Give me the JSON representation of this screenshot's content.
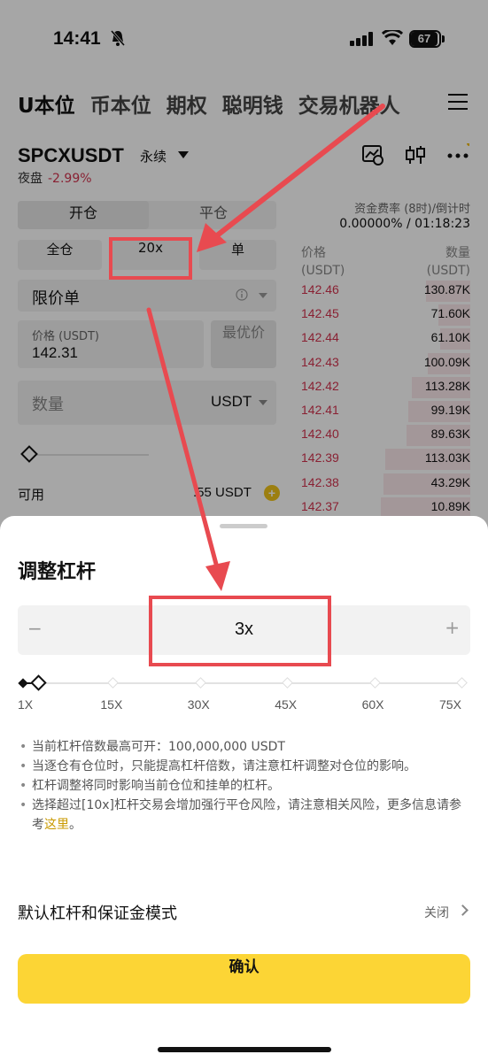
{
  "status": {
    "time": "14:41",
    "battery": "67"
  },
  "nav": {
    "tabs": [
      "U本位",
      "币本位",
      "期权",
      "聪明钱",
      "交易机器人"
    ]
  },
  "pair": {
    "symbol": "SPCXUSDT",
    "type": "永续",
    "session": "夜盘",
    "change": "-2.99%"
  },
  "form": {
    "open_tab": "开仓",
    "close_tab": "平仓",
    "margin_mode": "全仓",
    "leverage": "20x",
    "position_mode": "单",
    "order_type": "限价单",
    "price_label": "价格 (USDT)",
    "price_value": "142.31",
    "best_price": "最优价",
    "qty_placeholder": "数量",
    "qty_unit": "USDT",
    "available_label": "可用",
    "available_value": ".55 USDT",
    "coin_icon": "+"
  },
  "orderbook": {
    "funding_label": "资金费率 (8时)/倒计时",
    "funding_value": "0.00000% / 01:18:23",
    "price_header": "价格",
    "price_unit": "(USDT)",
    "amount_header": "数量",
    "amount_unit": "(USDT)",
    "rows": [
      {
        "price": "142.46",
        "amount": "130.87K",
        "depth": 0.42
      },
      {
        "price": "142.45",
        "amount": "71.60K",
        "depth": 0.3
      },
      {
        "price": "142.44",
        "amount": "61.10K",
        "depth": 0.28
      },
      {
        "price": "142.43",
        "amount": "100.09K",
        "depth": 0.4
      },
      {
        "price": "142.42",
        "amount": "113.28K",
        "depth": 0.55
      },
      {
        "price": "142.41",
        "amount": "99.19K",
        "depth": 0.58
      },
      {
        "price": "142.40",
        "amount": "89.63K",
        "depth": 0.6
      },
      {
        "price": "142.39",
        "amount": "113.03K",
        "depth": 0.8
      },
      {
        "price": "142.38",
        "amount": "43.29K",
        "depth": 0.82
      },
      {
        "price": "142.37",
        "amount": "10.89K",
        "depth": 0.84
      }
    ]
  },
  "sheet": {
    "title": "调整杠杆",
    "minus": "−",
    "plus": "+",
    "value": "3x",
    "leverage_fraction": 0.027,
    "marks": [
      "1X",
      "15X",
      "30X",
      "45X",
      "60X",
      "75X"
    ],
    "notes": [
      "当前杠杆倍数最高可开：100,000,000 USDT",
      "当逐仓有仓位时，只能提高杠杆倍数，请注意杠杆调整对仓位的影响。",
      "杠杆调整将同时影响当前仓位和挂单的杠杆。",
      "选择超过[10x]杠杆交易会增加强行平仓风险，请注意相关风险，更多信息请参考"
    ],
    "note_link": "这里",
    "note_end": "。",
    "default_label": "默认杠杆和保证金模式",
    "default_state": "关闭",
    "confirm": "确认"
  },
  "colors": {
    "accent": "#fcd535",
    "sell": "#d3344f",
    "annotation": "#e84a50"
  }
}
